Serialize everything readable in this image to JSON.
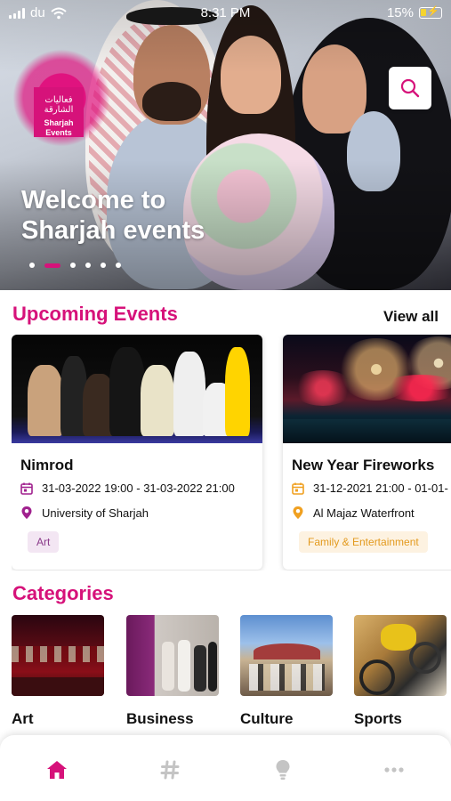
{
  "status_bar": {
    "carrier": "du",
    "time": "8:31 PM",
    "battery": "15%"
  },
  "hero": {
    "logo_ar": "فعاليات الشارقة",
    "logo_en_1": "Sharjah",
    "logo_en_2": "Events",
    "title_line1": "Welcome to",
    "title_line2": "Sharjah events",
    "slides_total": 6,
    "active_slide": 2
  },
  "upcoming": {
    "title": "Upcoming Events",
    "view_all": "View all",
    "events": [
      {
        "name": "Nimrod",
        "datetime": "31-03-2022 19:00 - 31-03-2022 21:00",
        "location": "University of Sharjah",
        "tag": "Art",
        "tag_color": "#f3e6f3",
        "tag_text_color": "#8a3a8a",
        "icon_color": "#a0218e"
      },
      {
        "name": "New Year Fireworks",
        "datetime": "31-12-2021 21:00 - 01-01-",
        "location": "Al Majaz Waterfront",
        "tag": "Family & Entertainment",
        "tag_color": "#fdf2e1",
        "tag_text_color": "#e39a1e",
        "icon_color": "#f0a020"
      }
    ]
  },
  "categories": {
    "title": "Categories",
    "items": [
      {
        "label": "Art"
      },
      {
        "label": "Business"
      },
      {
        "label": "Culture"
      },
      {
        "label": "Sports"
      }
    ]
  },
  "tabbar": {
    "items": [
      {
        "icon": "home-icon",
        "active": true
      },
      {
        "icon": "hashtag-icon",
        "active": false
      },
      {
        "icon": "lightbulb-icon",
        "active": false
      },
      {
        "icon": "more-icon",
        "active": false
      }
    ],
    "active_color": "#d6127a",
    "inactive_color": "#c4c4c4"
  },
  "colors": {
    "brand": "#d6127a"
  }
}
